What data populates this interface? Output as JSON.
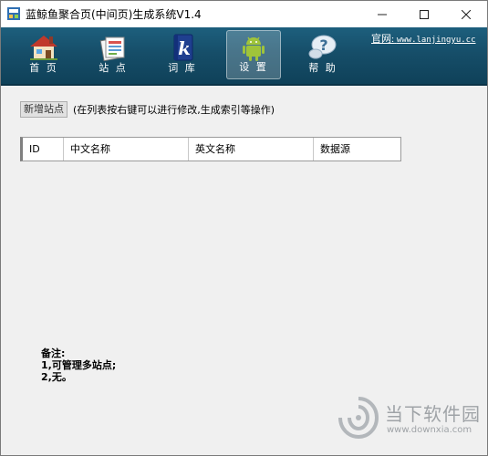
{
  "window": {
    "title": "蓝鲸鱼聚合页(中间页)生成系统V1.4"
  },
  "toolbar": {
    "items": [
      {
        "label": "首 页",
        "icon": "house-icon"
      },
      {
        "label": "站 点",
        "icon": "pages-icon"
      },
      {
        "label": "词 库",
        "icon": "k-book-icon"
      },
      {
        "label": "设 置",
        "icon": "android-icon",
        "active": true
      },
      {
        "label": "帮 助",
        "icon": "help-bubble-icon"
      }
    ],
    "official_prefix": "官网:",
    "official_url": "www.lanjingyu.cc"
  },
  "main": {
    "add_site_label": "新增站点",
    "hint": "(在列表按右键可以进行修改,生成索引等操作)",
    "table": {
      "columns": [
        "ID",
        "中文名称",
        "英文名称",
        "数据源"
      ],
      "rows": []
    },
    "notes": {
      "title": "备注:",
      "line1": "1,可管理多站点;",
      "line2": "2,无。"
    }
  },
  "watermark": {
    "text": "当下软件园",
    "url": "www.downxia.com"
  },
  "colors": {
    "toolbar_top": "#1d5f7d",
    "toolbar_bottom": "#0f4159",
    "window_bg": "#f0f0f0"
  }
}
